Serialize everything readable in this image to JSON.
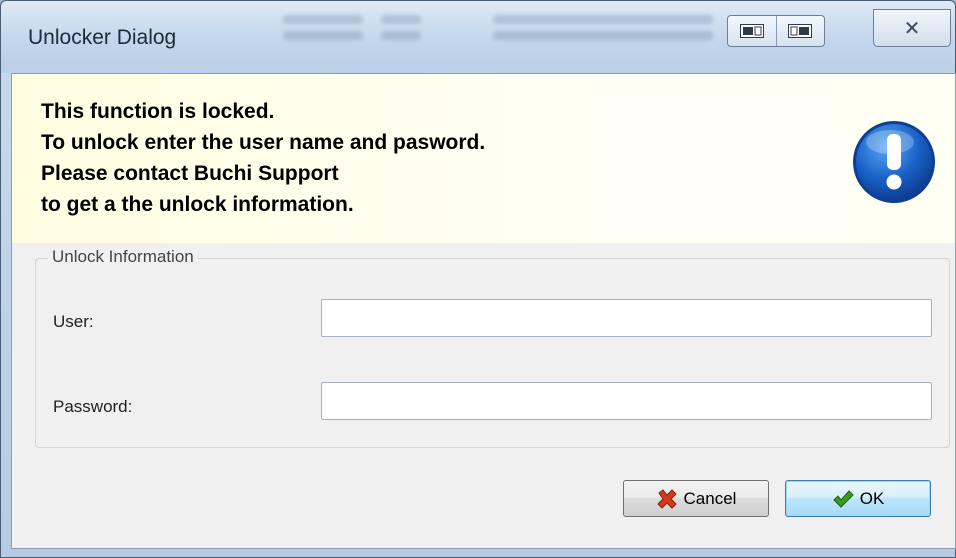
{
  "window": {
    "title": "Unlocker Dialog",
    "close_glyph": "✕"
  },
  "banner": {
    "lines": [
      "This function is locked.",
      "To unlock enter the user name and pasword.",
      "Please contact Buchi Support",
      "to get a the unlock information."
    ],
    "icon": "exclamation-info-icon",
    "icon_color": "#1a62c8"
  },
  "group": {
    "legend": "Unlock Information",
    "user_label": "User:",
    "user_value": "",
    "password_label": "Password:",
    "password_value": ""
  },
  "buttons": {
    "cancel_label": "Cancel",
    "ok_label": "OK"
  },
  "colors": {
    "cancel_icon": "#d23a1c",
    "ok_icon": "#3a9a1e"
  }
}
